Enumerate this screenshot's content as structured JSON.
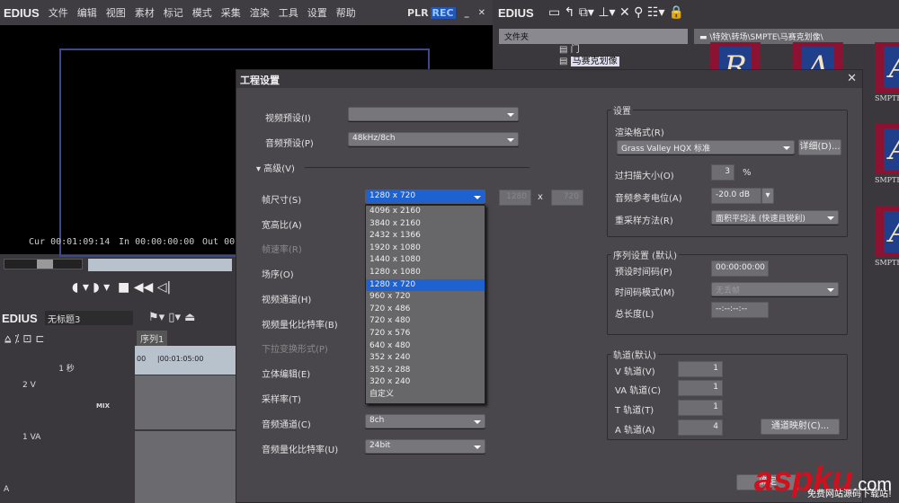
{
  "app": {
    "logo": "EDIUS",
    "menu": [
      "文件",
      "编辑",
      "视图",
      "素材",
      "标记",
      "模式",
      "采集",
      "渲染",
      "工具",
      "设置",
      "帮助"
    ],
    "plr": "PLR",
    "rec": "REC"
  },
  "monitor": {
    "cur_label": "Cur",
    "cur": "00:01:09:14",
    "in_label": "In",
    "in": "00:00:00:00",
    "out_label": "Out",
    "out": "00:"
  },
  "bin": {
    "logo": "EDIUS",
    "folder_header": "文件夹",
    "path": "\\特效\\转场\\SMPTE\\马赛克划像\\",
    "folders": [
      "门",
      "马赛克划像"
    ],
    "thumbs": [
      "R",
      "A",
      "A",
      "A",
      "A"
    ],
    "thumb_label": "SMPTE"
  },
  "timeline": {
    "logo": "EDIUS",
    "project": "无标题3",
    "seq_tab": "序列1",
    "scale": "1 秒",
    "ruler": [
      "00",
      "00:01:05:00"
    ],
    "tracks": [
      {
        "name": "2 V",
        "mix": "MIX"
      },
      {
        "name": "1 VA"
      }
    ],
    "a_label": "A"
  },
  "dialog": {
    "title": "工程设置",
    "video_preset_label": "视频预设(I)",
    "video_preset": "",
    "audio_preset_label": "音频预设(P)",
    "audio_preset": "48kHz/8ch",
    "advanced": "高级(V)",
    "frame_size_label": "帧尺寸(S)",
    "frame_size": "1280 x 720",
    "width": "1280",
    "x": "x",
    "height": "720",
    "labels": [
      "宽高比(A)",
      "帧速率(R)",
      "场序(O)",
      "视频通道(H)",
      "视频量化比特率(B)",
      "下拉变换形式(P)",
      "立体编辑(E)",
      "采样率(T)"
    ],
    "audio_channels_label": "音频通道(C)",
    "audio_channels": "8ch",
    "audio_bits_label": "音频量化比特率(U)",
    "audio_bits": "24bit",
    "frame_options": [
      "4096 x 2160",
      "3840 x 2160",
      "2432 x 1366",
      "1920 x 1080",
      "1440 x 1080",
      "1280 x 1080",
      "1280 x 720",
      "960 x 720",
      "720 x 486",
      "720 x 480",
      "720 x 576",
      "640 x 480",
      "352 x 240",
      "352 x 288",
      "320 x 240",
      "自定义"
    ],
    "settings": {
      "title": "设置",
      "render_label": "渲染格式(R)",
      "render": "Grass Valley HQX 标准",
      "detail_btn": "详细(D)...",
      "overscan_label": "过扫描大小(O)",
      "overscan": "3",
      "pct": "%",
      "audio_ref_label": "音频参考电位(A)",
      "audio_ref": "-20.0 dB",
      "resample_label": "重采样方法(R)",
      "resample": "面积平均法 (快速且锐利)"
    },
    "sequence": {
      "title": "序列设置 (默认)",
      "tc_preset_label": "预设时间码(P)",
      "tc_preset": "00:00:00:00",
      "tc_mode_label": "时间码模式(M)",
      "tc_mode": "无丢帧",
      "total_label": "总长度(L)",
      "total": "--:--:--:--"
    },
    "tracks": {
      "title": "轨道(默认)",
      "v_label": "V 轨道(V)",
      "v": "1",
      "va_label": "VA 轨道(C)",
      "va": "1",
      "t_label": "T 轨道(T)",
      "t": "1",
      "a_label": "A 轨道(A)",
      "a": "4",
      "map_btn": "通道映射(C)...",
      "ok": "确定"
    }
  },
  "watermark": {
    "brand": "aspku",
    "tld": ".com",
    "slogan": "免费网站源码下载站!"
  }
}
